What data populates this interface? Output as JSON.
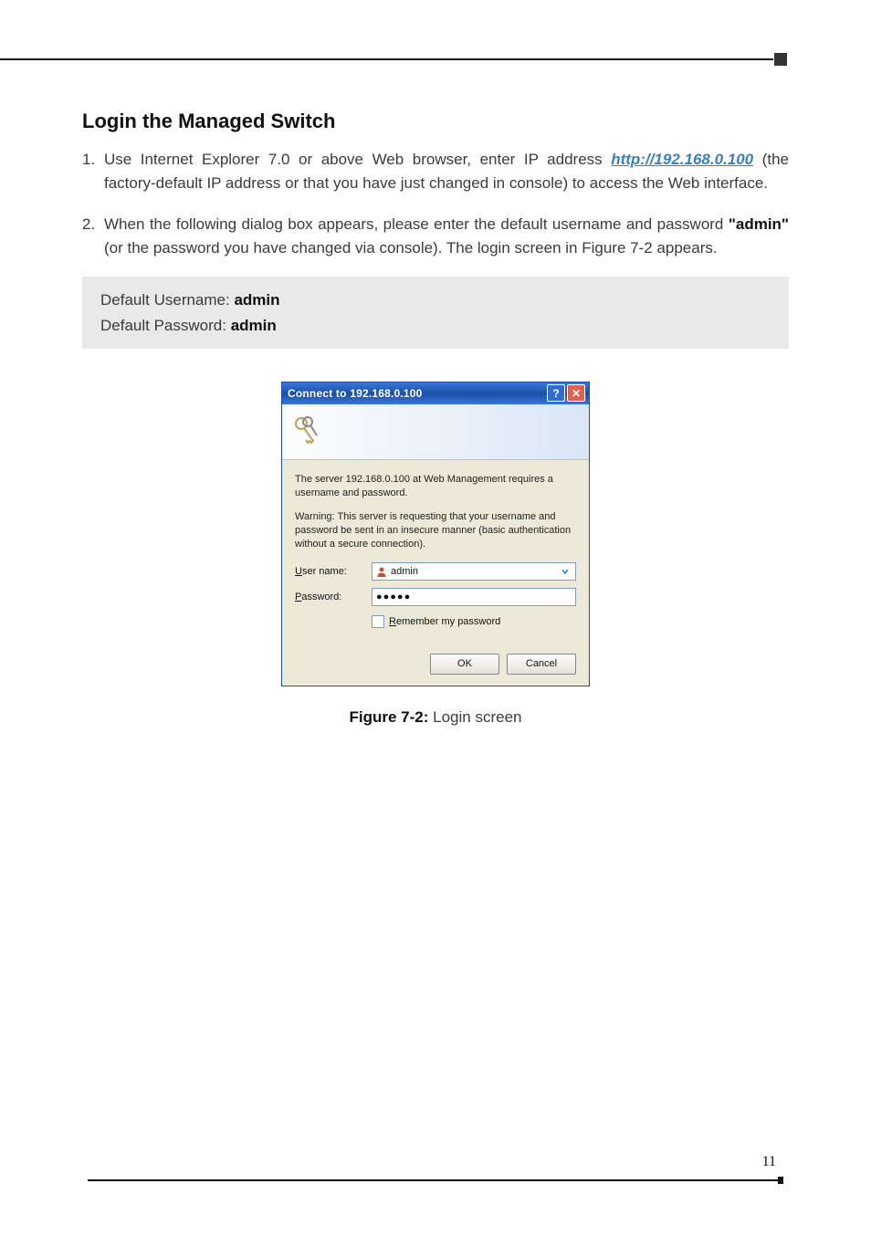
{
  "heading": "Login the Managed Switch",
  "steps": {
    "one_num": "1.",
    "one_a": "Use Internet Explorer 7.0 or above Web browser, enter IP address ",
    "one_link": "http://192.168.0.100",
    "one_b": " (the factory-default IP address or that you have just changed in console) to access the Web interface.",
    "two_num": "2.",
    "two_a": "When the following dialog box appears, please enter the default username and password ",
    "two_bold": "\"admin\"",
    "two_b": " (or the password you have changed via console). The login screen in Figure 7-2 appears."
  },
  "creds": {
    "u_label": "Default Username: ",
    "u_value": "admin",
    "p_label": "Default Password: ",
    "p_value": "admin"
  },
  "dialog": {
    "title": "Connect to 192.168.0.100",
    "help": "?",
    "close": "✕",
    "msg1": "The server 192.168.0.100 at Web Management requires a username and password.",
    "msg2": "Warning: This server is requesting that your username and password be sent in an insecure manner (basic authentication without a secure connection).",
    "user_label_u": "U",
    "user_label_rest": "ser name:",
    "pass_label_u": "P",
    "pass_label_rest": "assword:",
    "user_value": "admin",
    "pass_value": "●●●●●",
    "remember_u": "R",
    "remember_rest": "emember my password",
    "ok": "OK",
    "cancel": "Cancel"
  },
  "caption_bold": "Figure 7-2:",
  "caption_rest": "  Login screen",
  "page_number": "11"
}
